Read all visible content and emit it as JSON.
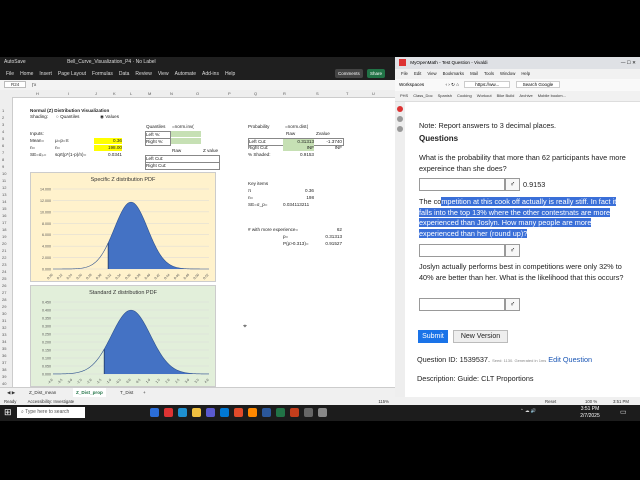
{
  "excel": {
    "window_title": "Bell_Curve_Visualization_P4 · No Label",
    "autosave": "AutoSave",
    "menu": [
      "File",
      "Home",
      "Insert",
      "Page Layout",
      "Formulas",
      "Data",
      "Review",
      "View",
      "Automate",
      "Add-ins",
      "Help"
    ],
    "comments_btn": "Comments",
    "share_btn": "Share",
    "name_box": "R24",
    "columns": [
      "H",
      "I",
      "J",
      "K",
      "L",
      "M",
      "N",
      "O",
      "P",
      "Q",
      "R",
      "S",
      "T",
      "U"
    ],
    "rows": [
      "1",
      "2",
      "3",
      "4",
      "5",
      "6",
      "7",
      "8",
      "9",
      "10",
      "11",
      "12",
      "13",
      "14",
      "15",
      "16",
      "17",
      "18",
      "19",
      "20",
      "21",
      "22",
      "23",
      "24",
      "25",
      "26",
      "27",
      "28",
      "29",
      "30",
      "31",
      "32",
      "33",
      "34",
      "35",
      "36",
      "37",
      "38",
      "39",
      "40",
      "41",
      "42"
    ],
    "sheet_title": "Normal (Z) Distribution Visualization",
    "shading_label": "Shading:",
    "shading_opt1": "Quantiles",
    "shading_opt2": "Values",
    "inputs_label": "Inputs:",
    "mean_label": "Mean=",
    "mean_formula": "μ=p=π",
    "mean_value": "0.36",
    "n_label": "n=",
    "n_sub": "n=",
    "n_value": "198.00",
    "sd_label": "SE=σₚ=",
    "sd_formula": "sqrt(p*(1-p)/n)=",
    "sd_value": "0.0341",
    "quantiles_label": "Quantiles",
    "quantiles_formula": "=norm.inv(",
    "left_pct": "Left %:",
    "right_pct": "Right %:",
    "raw_label": "Raw",
    "zvalue_label": "Z value",
    "left_cut_q": "Left Cut:",
    "right_cut_q": "Right Cut:",
    "prob_label": "Probability",
    "prob_formula": "=norm.dist(",
    "prob_raw": "Raw",
    "prob_z": "Zvalue",
    "left_cut": "Left Cut:",
    "left_cut_raw": "0.31313",
    "left_cut_z": "-1.3740",
    "right_cut": "Right Cut:",
    "right_cut_raw": "INF",
    "right_cut_z": "INF",
    "pct_shaded": "% Shaded:",
    "pct_shaded_val": "0.9153",
    "key_items": "Key items",
    "key_pi": "π",
    "key_pi_val": "0.36",
    "key_n": "n=",
    "key_n_val": "198",
    "key_se": "SE=σ_p=",
    "key_se_val": "0.034113211",
    "more_exp": "# with more experience=",
    "more_exp_val": "62",
    "p_label": "p=",
    "p_val": "0.31313",
    "prob_gt": "P(p>0.313)=",
    "prob_gt_val": "0.91527",
    "chart1_title": "Specific Z distribution PDF",
    "chart1_y": [
      "14.000",
      "12.000",
      "10.000",
      "8.000",
      "6.000",
      "4.000",
      "2.000",
      "0.000"
    ],
    "chart1_x": [
      "0.20",
      "0.22",
      "0.24",
      "0.26",
      "0.28",
      "0.30",
      "0.32",
      "0.34",
      "0.36",
      "0.38",
      "0.40",
      "0.42",
      "0.44",
      "0.46",
      "0.48",
      "0.50",
      "0.52"
    ],
    "chart2_title": "Standard Z distribution PDF",
    "chart2_y": [
      "0.450",
      "0.400",
      "0.350",
      "0.300",
      "0.250",
      "0.200",
      "0.150",
      "0.100",
      "0.050",
      "0.000"
    ],
    "chart2_x": [
      "-4.0",
      "-3.5",
      "-3.0",
      "-2.5",
      "-2.0",
      "-1.5",
      "-1.0",
      "-0.5",
      "0.0",
      "0.5",
      "1.0",
      "1.5",
      "2.0",
      "2.5",
      "3.0",
      "3.5",
      "4.0"
    ],
    "tabs": [
      "Z_Dist_mean",
      "Z_Dist_prop",
      "T_Dist"
    ],
    "active_tab": 1,
    "status_ready": "Ready",
    "status_access": "Accessibility: Investigate",
    "zoom": "115%"
  },
  "browser": {
    "tab_title": "MyOpenMath - Test Question - Vivaldi",
    "menu": [
      "File",
      "Edit",
      "View",
      "Bookmarks",
      "Mail",
      "Tools",
      "Window",
      "Help"
    ],
    "workspace": "Workspaces",
    "url": "https://ww...",
    "search_placeholder": "Search Google",
    "bookmarks": [
      "PHS",
      "Class_Doc",
      "Spanish",
      "Cooking",
      "Workout",
      "Bike Build",
      "Archive",
      "Mobile bookm..."
    ],
    "note": "Note: Report answers to 3 decimal places.",
    "questions_heading": "Questions",
    "q1": "What is the probability that more than 62 participants have more expereince than she does?",
    "q1_answer": "0.9153",
    "q2_before": "The co",
    "q2_highlight": "mpetition at this cook off actually is really stiff. In fact it falls into the top 13% where the other contestnats are more experienced than Joslyn. How many people are more experienced than her (round up)?",
    "q3": "Joslyn actually performs best in competitions were only 32% to 40% are better than her. What is the likelihood that this occurs?",
    "submit": "Submit",
    "new_version": "New Version",
    "question_id_label": "Question ID: 1539537.",
    "seed_text": "Seed: 1130. Generated in 1ms",
    "edit_question": "Edit Question",
    "description": "Description: Guide: CLT Proportions",
    "status_reset": "Reset",
    "status_zoom": "100 %",
    "status_time": "3:51 PM"
  },
  "taskbar": {
    "search_placeholder": "Type here to search",
    "weather": "3°F Cloudy",
    "time": "3:51 PM",
    "date": "2/7/2025"
  },
  "chart_data": [
    {
      "type": "area",
      "title": "Specific Z distribution PDF",
      "x": [
        0.2,
        0.22,
        0.24,
        0.26,
        0.28,
        0.3,
        0.32,
        0.34,
        0.36,
        0.38,
        0.4,
        0.42,
        0.44,
        0.46,
        0.48,
        0.5,
        0.52
      ],
      "ylim": [
        0,
        14
      ],
      "mean": 0.36,
      "sd": 0.0341,
      "shade_from": 0.31313
    },
    {
      "type": "area",
      "title": "Standard Z distribution PDF",
      "x": [
        -4.0,
        -3.5,
        -3.0,
        -2.5,
        -2.0,
        -1.5,
        -1.0,
        -0.5,
        0.0,
        0.5,
        1.0,
        1.5,
        2.0,
        2.5,
        3.0,
        3.5,
        4.0
      ],
      "ylim": [
        0,
        0.45
      ],
      "mean": 0,
      "sd": 1,
      "shade_from": -1.374
    }
  ],
  "colors": {
    "excel_green": "#217346",
    "curve_blue": "#4472c4",
    "submit_blue": "#1a73e8",
    "highlight": "#3a6fd8"
  }
}
